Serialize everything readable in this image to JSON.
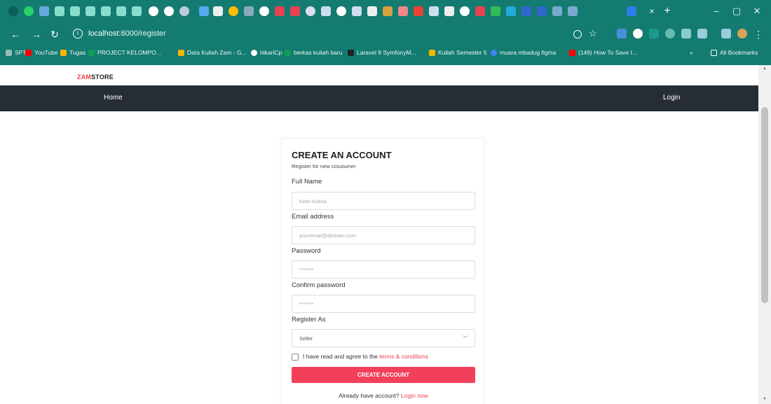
{
  "browser": {
    "tab_new": "+",
    "tab_close": "×",
    "window": {
      "minimize": "–",
      "restore": "▢",
      "close": "✕"
    },
    "nav": {
      "back": "←",
      "forward": "→",
      "reload": "↻"
    },
    "url_host": "localhost",
    "url_path": ":8000/register",
    "bookmarks": [
      {
        "label": "SPT",
        "color": "#9bb"
      },
      {
        "label": "YouTube",
        "color": "#ff0000"
      },
      {
        "label": "Tugas",
        "color": "#f4b400"
      },
      {
        "label": "PROJECT KELOMPO...",
        "color": "#0f9d58"
      },
      {
        "label": "Data Kuliah Zam - G...",
        "color": "#f4b400"
      },
      {
        "label": "hikariCp",
        "color": "#ffffff"
      },
      {
        "label": "berkas kuliah baru",
        "color": "#0f9d58"
      },
      {
        "label": "Laravel 9 SymfonyM...",
        "color": "#222222"
      },
      {
        "label": "Kuliah Semester 5",
        "color": "#f4b400"
      },
      {
        "label": "muara mbadug figma",
        "color": "#4285f4"
      },
      {
        "label": "(149) How To Save I...",
        "color": "#ff0000"
      }
    ],
    "bookmarks_more": "»",
    "all_bookmarks": "All Bookmarks"
  },
  "app": {
    "brand_part1": "ZAM",
    "brand_part2": "STORE",
    "nav_home": "Home",
    "nav_login": "Login"
  },
  "form": {
    "title": "CREATE AN ACCOUNT",
    "subtitle": "Register for new cosutumer",
    "full_name_label": "Full Name",
    "full_name_placeholder": "fulan fulana",
    "email_label": "Email address",
    "email_placeholder": "youremail@domain.com",
    "password_label": "Password",
    "password_placeholder": "*******",
    "confirm_label": "Confirm password",
    "confirm_placeholder": "*******",
    "register_as_label": "Register As",
    "register_as_value": "Seller",
    "agree_text": "I have read and agree to the ",
    "terms_link": "terms & conditions",
    "submit_label": "CREATE ACCOUNT",
    "footer_text": "Already have account? ",
    "login_link": "Login now"
  },
  "colors": {
    "chrome": "#137b70",
    "accent": "#f2405b",
    "navbar": "#272d35"
  }
}
